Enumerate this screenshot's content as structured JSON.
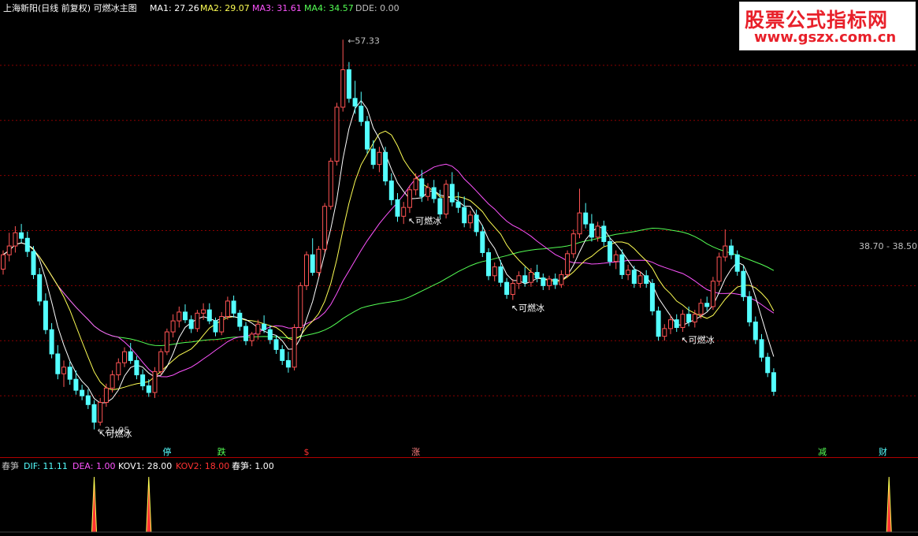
{
  "header": {
    "title": "上海新阳(日线 前复权) 可燃冰主图",
    "ma1": "MA1: 27.26",
    "ma2": "MA2: 29.07",
    "ma3": "MA3: 31.61",
    "ma4": "MA4: 34.57",
    "dde": "DDE: 0.00"
  },
  "sub_header": {
    "name": "春笋",
    "dif": "DIF: 11.11",
    "dea": "DEA: 1.00",
    "kov1": "KOV1: 28.00",
    "kov2": "KOV2: 18.00",
    "chunsun": "春笋: 1.00"
  },
  "watermark": {
    "line1": "股票公式指标网",
    "line2": "www.gszx.com.cn"
  },
  "colors": {
    "background": "#000000",
    "up": "#ff5454",
    "down": "#54ffff",
    "ma1": "#ffffff",
    "ma2": "#ffff54",
    "ma3": "#ff54ff",
    "ma4": "#54ff54",
    "grid": "#8b0000",
    "dif": "#54ffff",
    "dea": "#ff54ff",
    "kov2": "#ff3232"
  },
  "chart_data": {
    "type": "candlestick",
    "title": "上海新阳(日线 前复权) 可燃冰主图",
    "y_range": [
      20.5,
      59.5
    ],
    "max_label": "57.33",
    "min_label": "21.95",
    "right_label": "38.70 - 38.50",
    "signal_label": "可燃冰",
    "ohlc": [
      [
        36.5,
        38.2,
        36.0,
        37.8
      ],
      [
        37.8,
        39.8,
        37.2,
        38.6
      ],
      [
        38.6,
        40.4,
        38.0,
        39.8
      ],
      [
        39.8,
        40.6,
        38.9,
        39.3
      ],
      [
        39.3,
        39.9,
        37.6,
        38.1
      ],
      [
        38.1,
        38.6,
        35.6,
        36.0
      ],
      [
        36.0,
        36.6,
        33.2,
        33.6
      ],
      [
        33.6,
        34.3,
        30.6,
        31.0
      ],
      [
        31.0,
        31.6,
        28.4,
        28.8
      ],
      [
        28.8,
        29.6,
        26.5,
        27.0
      ],
      [
        27.0,
        28.2,
        25.8,
        27.6
      ],
      [
        27.6,
        28.1,
        26.0,
        26.5
      ],
      [
        26.5,
        27.3,
        25.1,
        25.5
      ],
      [
        25.5,
        26.0,
        24.6,
        25.0
      ],
      [
        25.0,
        25.6,
        23.8,
        24.2
      ],
      [
        24.2,
        24.6,
        21.95,
        22.6
      ],
      [
        22.6,
        24.8,
        22.3,
        24.4
      ],
      [
        24.4,
        26.1,
        24.0,
        25.7
      ],
      [
        25.7,
        27.3,
        25.3,
        26.9
      ],
      [
        26.9,
        28.4,
        26.4,
        28.0
      ],
      [
        28.0,
        29.4,
        27.6,
        29.0
      ],
      [
        29.0,
        29.8,
        27.9,
        28.2
      ],
      [
        28.2,
        28.6,
        26.5,
        26.9
      ],
      [
        26.9,
        27.4,
        25.5,
        25.9
      ],
      [
        25.9,
        26.5,
        24.9,
        25.3
      ],
      [
        25.3,
        27.6,
        24.8,
        27.2
      ],
      [
        27.2,
        29.3,
        26.9,
        29.0
      ],
      [
        29.0,
        31.1,
        28.7,
        30.8
      ],
      [
        30.8,
        32.4,
        30.3,
        31.8
      ],
      [
        31.8,
        33.1,
        31.2,
        32.6
      ],
      [
        32.6,
        33.3,
        31.6,
        31.9
      ],
      [
        31.9,
        32.3,
        30.7,
        31.1
      ],
      [
        31.1,
        32.8,
        30.8,
        32.5
      ],
      [
        32.5,
        33.4,
        31.9,
        32.8
      ],
      [
        32.8,
        33.4,
        31.5,
        31.8
      ],
      [
        31.8,
        32.1,
        30.4,
        30.8
      ],
      [
        30.8,
        32.6,
        30.5,
        32.2
      ],
      [
        32.2,
        34.0,
        31.9,
        33.6
      ],
      [
        33.6,
        34.1,
        32.1,
        32.5
      ],
      [
        32.5,
        32.8,
        30.9,
        31.3
      ],
      [
        31.3,
        31.7,
        29.6,
        30.0
      ],
      [
        30.0,
        30.8,
        29.5,
        30.6
      ],
      [
        30.6,
        31.9,
        30.1,
        31.5
      ],
      [
        31.5,
        32.3,
        30.7,
        31.0
      ],
      [
        31.0,
        31.4,
        29.7,
        30.1
      ],
      [
        30.1,
        30.5,
        28.8,
        29.2
      ],
      [
        29.2,
        29.6,
        27.8,
        28.2
      ],
      [
        28.2,
        29.0,
        27.1,
        27.6
      ],
      [
        27.6,
        31.5,
        27.3,
        31.2
      ],
      [
        31.2,
        35.3,
        30.9,
        35.0
      ],
      [
        35.0,
        38.1,
        34.6,
        37.8
      ],
      [
        37.8,
        39.3,
        35.9,
        36.2
      ],
      [
        36.2,
        38.6,
        35.8,
        38.3
      ],
      [
        38.3,
        42.5,
        38.0,
        42.2
      ],
      [
        42.2,
        46.6,
        41.9,
        46.3
      ],
      [
        46.3,
        51.6,
        45.9,
        51.2
      ],
      [
        51.2,
        57.33,
        50.8,
        54.6
      ],
      [
        54.6,
        55.3,
        51.6,
        52.0
      ],
      [
        52.0,
        53.6,
        50.6,
        51.3
      ],
      [
        51.3,
        52.6,
        49.5,
        49.9
      ],
      [
        49.9,
        50.4,
        47.0,
        47.4
      ],
      [
        47.4,
        48.2,
        45.6,
        46.0
      ],
      [
        46.0,
        47.6,
        45.3,
        47.1
      ],
      [
        47.1,
        47.6,
        44.1,
        44.5
      ],
      [
        44.5,
        45.2,
        42.3,
        42.8
      ],
      [
        42.8,
        43.4,
        40.8,
        41.3
      ],
      [
        41.3,
        42.6,
        40.6,
        42.1
      ],
      [
        42.1,
        44.1,
        41.6,
        43.7
      ],
      [
        43.7,
        45.2,
        43.2,
        44.7
      ],
      [
        44.7,
        45.5,
        42.6,
        43.1
      ],
      [
        43.1,
        44.3,
        42.7,
        43.9
      ],
      [
        43.9,
        44.6,
        42.5,
        42.9
      ],
      [
        42.9,
        43.7,
        41.1,
        41.5
      ],
      [
        41.5,
        44.6,
        41.1,
        44.2
      ],
      [
        44.2,
        45.3,
        42.2,
        42.6
      ],
      [
        42.6,
        43.5,
        41.6,
        42.1
      ],
      [
        42.1,
        43.1,
        40.3,
        40.7
      ],
      [
        40.7,
        41.8,
        40.2,
        41.4
      ],
      [
        41.4,
        41.9,
        39.5,
        39.9
      ],
      [
        39.9,
        40.5,
        37.6,
        38.0
      ],
      [
        38.0,
        38.4,
        35.5,
        35.9
      ],
      [
        35.9,
        37.1,
        35.4,
        36.7
      ],
      [
        36.7,
        37.3,
        34.9,
        35.3
      ],
      [
        35.3,
        35.7,
        33.8,
        34.2
      ],
      [
        34.2,
        35.6,
        33.7,
        35.2
      ],
      [
        35.2,
        36.3,
        34.7,
        35.9
      ],
      [
        35.9,
        36.7,
        34.9,
        35.3
      ],
      [
        35.3,
        36.6,
        34.9,
        36.2
      ],
      [
        36.2,
        36.9,
        35.3,
        35.7
      ],
      [
        35.7,
        36.1,
        34.6,
        35.0
      ],
      [
        35.0,
        35.9,
        34.6,
        35.6
      ],
      [
        35.6,
        36.1,
        34.7,
        35.1
      ],
      [
        35.1,
        36.4,
        34.8,
        36.0
      ],
      [
        36.0,
        38.2,
        35.7,
        37.9
      ],
      [
        37.9,
        40.1,
        37.5,
        39.7
      ],
      [
        39.7,
        43.8,
        39.3,
        41.6
      ],
      [
        41.6,
        42.5,
        40.2,
        40.6
      ],
      [
        40.6,
        41.5,
        39.0,
        39.4
      ],
      [
        39.4,
        40.8,
        39.0,
        40.4
      ],
      [
        40.4,
        40.9,
        38.6,
        39.0
      ],
      [
        39.0,
        39.4,
        36.8,
        37.2
      ],
      [
        37.2,
        38.2,
        36.5,
        37.8
      ],
      [
        37.8,
        38.3,
        35.6,
        36.0
      ],
      [
        36.0,
        36.9,
        35.5,
        36.4
      ],
      [
        36.4,
        36.8,
        34.8,
        35.2
      ],
      [
        35.2,
        36.3,
        34.8,
        35.9
      ],
      [
        35.9,
        36.4,
        34.8,
        35.2
      ],
      [
        35.2,
        35.6,
        32.3,
        32.7
      ],
      [
        32.7,
        33.1,
        30.0,
        30.4
      ],
      [
        30.4,
        31.5,
        30.0,
        31.1
      ],
      [
        31.1,
        32.3,
        30.6,
        31.9
      ],
      [
        31.9,
        32.4,
        30.8,
        31.2
      ],
      [
        31.2,
        32.8,
        30.8,
        32.4
      ],
      [
        32.4,
        33.1,
        31.3,
        31.7
      ],
      [
        31.7,
        32.8,
        31.2,
        32.4
      ],
      [
        32.4,
        33.8,
        32.0,
        33.4
      ],
      [
        33.4,
        34.0,
        32.7,
        33.1
      ],
      [
        33.1,
        35.8,
        32.8,
        35.4
      ],
      [
        35.4,
        38.0,
        35.0,
        37.6
      ],
      [
        37.6,
        40.1,
        37.2,
        38.6
      ],
      [
        38.6,
        39.2,
        37.4,
        37.8
      ],
      [
        37.8,
        38.2,
        35.9,
        36.3
      ],
      [
        36.3,
        36.8,
        33.6,
        34.0
      ],
      [
        34.0,
        34.5,
        31.3,
        31.7
      ],
      [
        31.7,
        32.2,
        29.7,
        30.1
      ],
      [
        30.1,
        30.6,
        28.1,
        28.5
      ],
      [
        28.5,
        28.9,
        26.7,
        27.1
      ],
      [
        27.1,
        27.5,
        25.0,
        25.4
      ]
    ],
    "ma1": "5-period average of close",
    "ma2": "10-period average of close",
    "ma3": "20-period average of close",
    "ma4": "60-period average of close",
    "markers": [
      {
        "text": "停",
        "index": 27,
        "color": "#54ffff"
      },
      {
        "text": "跌",
        "index": 36,
        "color": "#54ff54"
      },
      {
        "text": "$",
        "index": 50,
        "color": "#ff3232"
      },
      {
        "text": "涨",
        "index": 68,
        "color": "#ff8080"
      },
      {
        "text": "减",
        "index": 135,
        "color": "#54ff54"
      },
      {
        "text": "财",
        "index": 145,
        "color": "#54ffff"
      }
    ],
    "indicator": {
      "name": "春笋",
      "y_range": [
        0,
        1.0
      ],
      "spikes": [
        {
          "index": 15,
          "value": 1.0
        },
        {
          "index": 24,
          "value": 1.0
        },
        {
          "index": 146,
          "value": 1.0
        }
      ]
    }
  }
}
